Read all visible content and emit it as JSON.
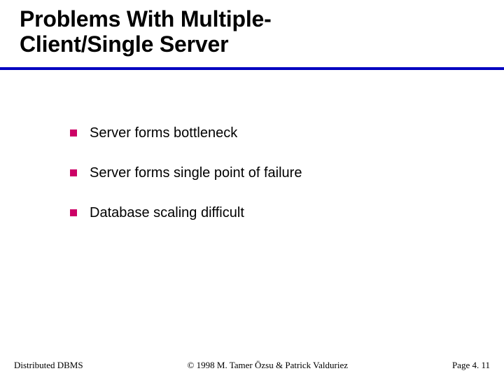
{
  "title_line1": "Problems With Multiple-",
  "title_line2": "Client/Single Server",
  "bullets": {
    "b0": "Server forms bottleneck",
    "b1": "Server forms single point of failure",
    "b2": "Database scaling difficult"
  },
  "footer": {
    "left": "Distributed DBMS",
    "center": "© 1998 M. Tamer Özsu & Patrick Valduriez",
    "right": "Page 4. 11"
  },
  "colors": {
    "rule": "#0000c0",
    "bullet": "#cc0066"
  }
}
